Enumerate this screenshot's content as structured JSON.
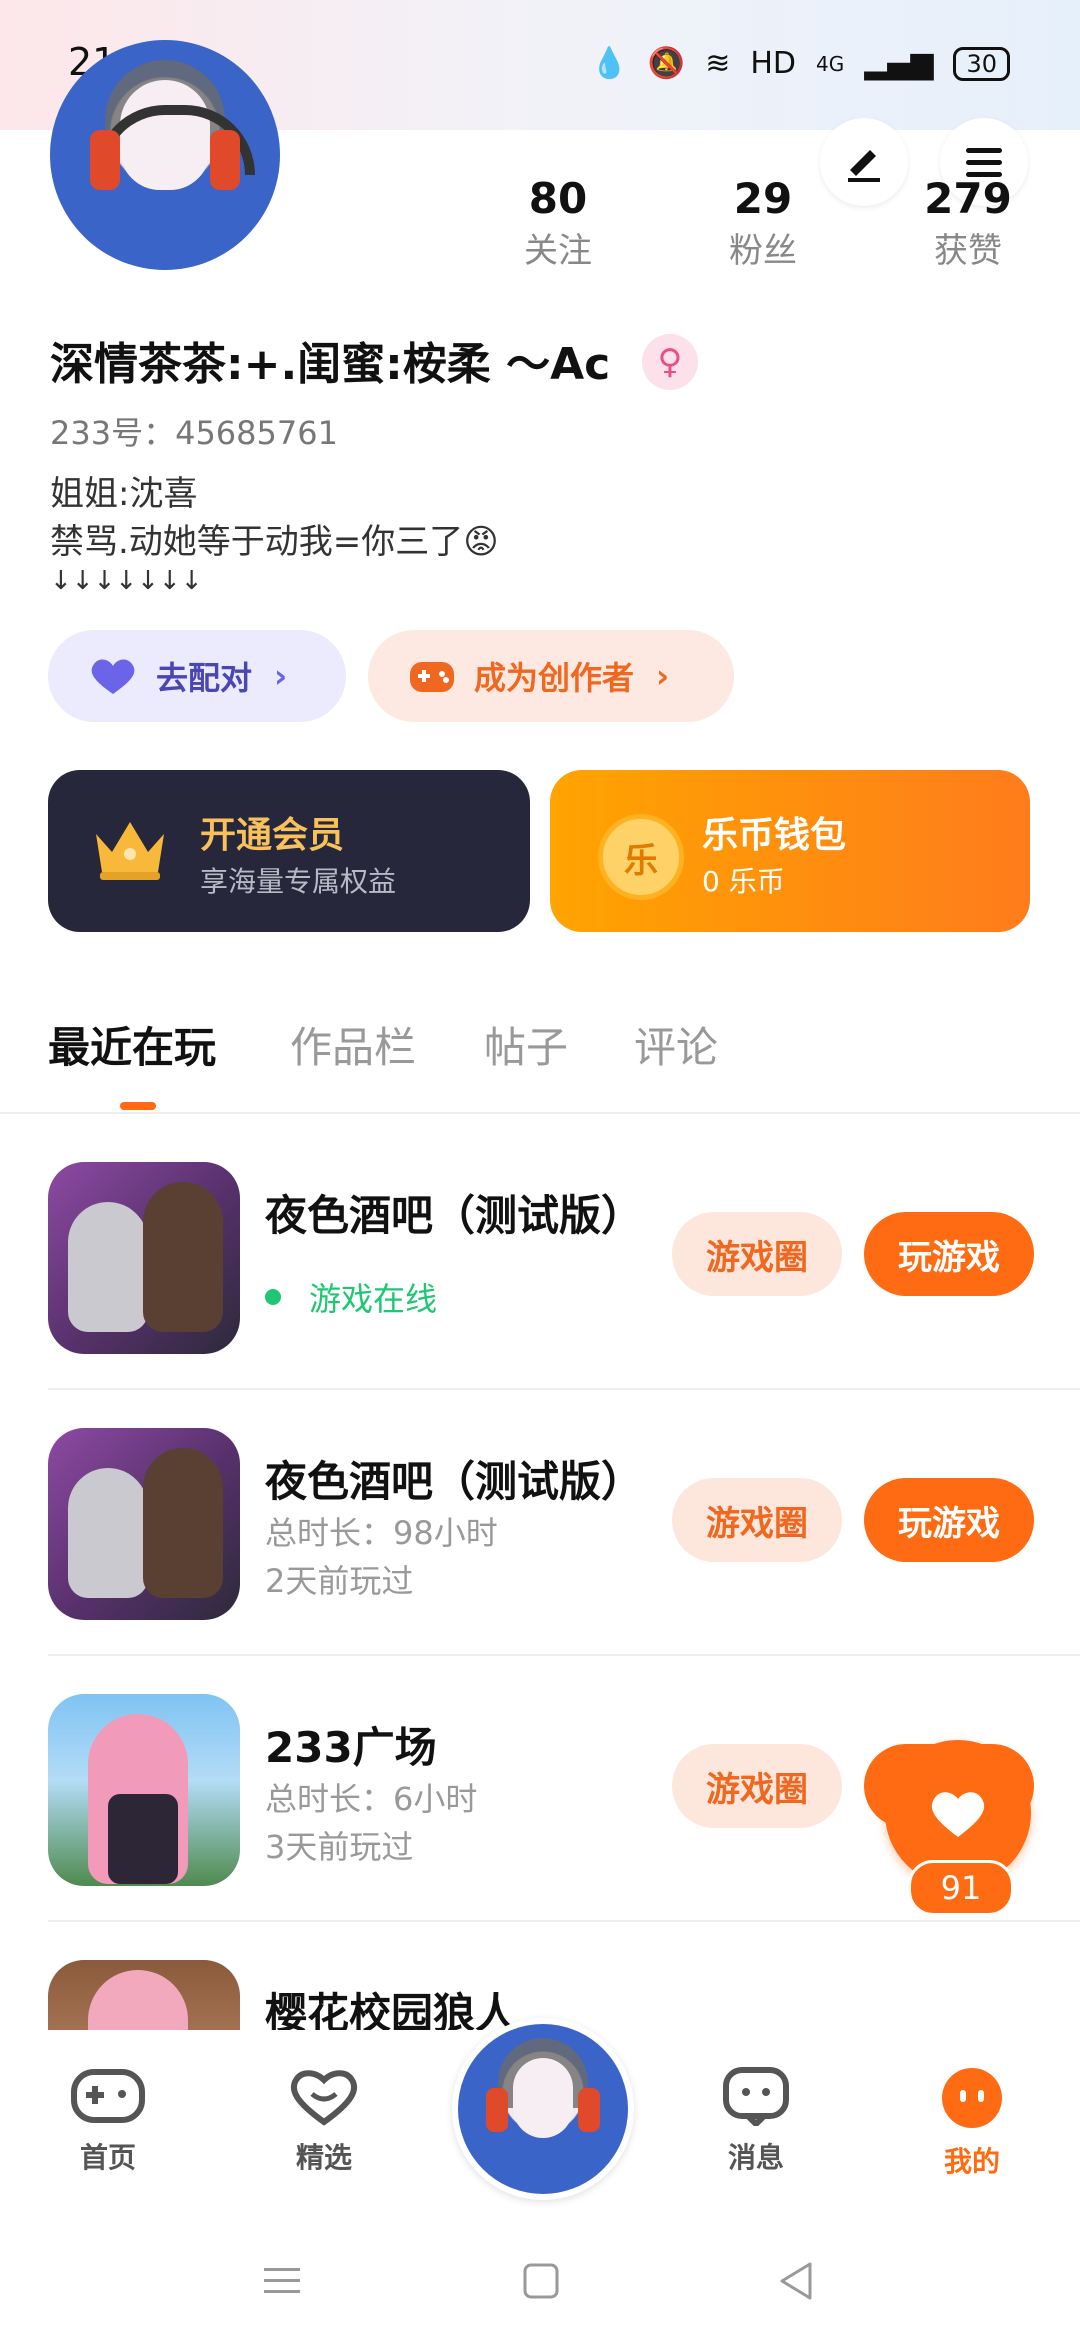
{
  "status_bar": {
    "time": "21:35",
    "network": "HD",
    "signal": "4G",
    "battery": "30"
  },
  "profile": {
    "stats": [
      {
        "value": "80",
        "label": "关注"
      },
      {
        "value": "29",
        "label": "粉丝"
      },
      {
        "value": "279",
        "label": "获赞"
      }
    ],
    "name": "深情茶茶:+.闺蜜:桉柔 ～Ac",
    "gender_icon": "♀",
    "uid": "233号：45685761",
    "bio_lines": [
      "姐姐:沈喜",
      "禁骂.动她等于动我=你三了😡",
      "↓↓↓↓↓↓↓"
    ]
  },
  "actions": {
    "pair": "去配对",
    "creator": "成为创作者"
  },
  "cards": {
    "vip": {
      "title": "开通会员",
      "subtitle": "享海量专属权益"
    },
    "wallet": {
      "icon_text": "乐",
      "title": "乐币钱包",
      "subtitle": "0 乐币"
    }
  },
  "tabs": [
    "最近在玩",
    "作品栏",
    "帖子",
    "评论"
  ],
  "games": [
    {
      "title": "夜色酒吧（测试版）",
      "status": "游戏在线",
      "circle_btn": "游戏圈",
      "play_btn": "玩游戏"
    },
    {
      "title": "夜色酒吧（测试版）",
      "duration": "总时长：98小时",
      "last_played": "2天前玩过",
      "circle_btn": "游戏圈",
      "play_btn": "玩游戏"
    },
    {
      "title": "233广场",
      "duration": "总时长：6小时",
      "last_played": "3天前玩过",
      "circle_btn": "游戏圈",
      "play_btn": "玩游戏"
    },
    {
      "title": "樱花校园狼人"
    }
  ],
  "float_like": {
    "count": "91"
  },
  "bottom_nav": [
    {
      "label": "首页"
    },
    {
      "label": "精选"
    },
    {
      "label": ""
    },
    {
      "label": "消息"
    },
    {
      "label": "我的"
    }
  ],
  "colors": {
    "accent": "#ff6b13",
    "online": "#1ec773",
    "vip_bg": "#27273b"
  }
}
